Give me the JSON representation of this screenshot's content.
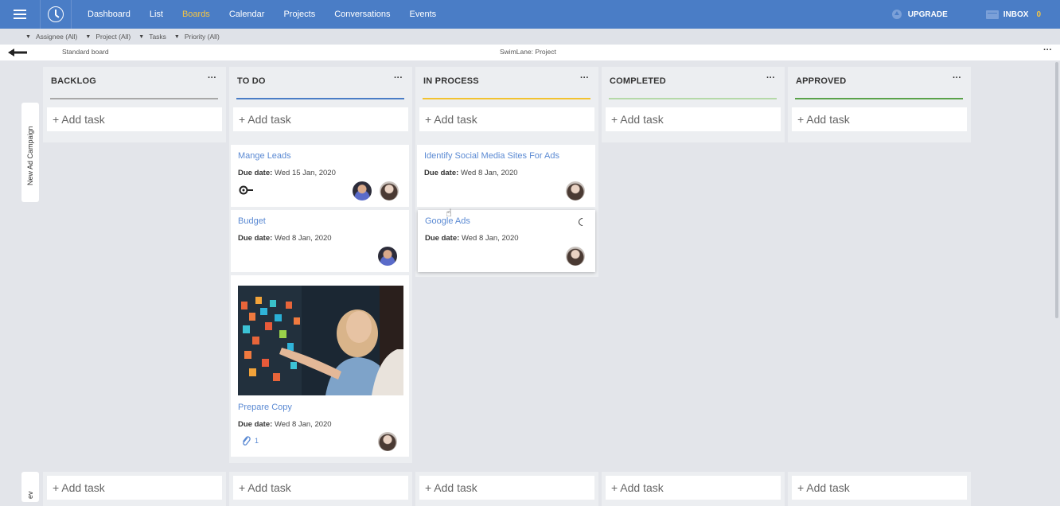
{
  "nav": {
    "items": [
      "Dashboard",
      "List",
      "Boards",
      "Calendar",
      "Projects",
      "Conversations",
      "Events"
    ],
    "active": "Boards",
    "upgrade_label": "UPGRADE",
    "inbox_label": "INBOX",
    "inbox_count": "0"
  },
  "filters": [
    "Assignee (All)",
    "Project (All)",
    "Tasks",
    "Priority (All)"
  ],
  "board": {
    "name": "Standard board",
    "swimlane_label": "SwimLane: Project",
    "more": "···"
  },
  "swimlanes": [
    "New Ad Campaign",
    "ev"
  ],
  "add_task_label": "+ Add task",
  "due_label": "Due date:",
  "colors": {
    "accent": "#4a7dc6",
    "highlight": "#f5c542",
    "link": "#5b8ad3"
  },
  "columns": [
    {
      "title": "BACKLOG",
      "more": "···",
      "color": "#a8a8a8"
    },
    {
      "title": "TO DO",
      "more": "···",
      "color": "#4a7dc6"
    },
    {
      "title": "IN PROCESS",
      "more": "···",
      "color": "#f2c230"
    },
    {
      "title": "COMPLETED",
      "more": "···",
      "color": "#b5d9a8"
    },
    {
      "title": "APPROVED",
      "more": "···",
      "color": "#5aa24a"
    }
  ],
  "cards": {
    "todo": [
      {
        "title": "Mange Leads",
        "due": "Wed 15 Jan, 2020",
        "icon": "toggle-icon"
      },
      {
        "title": "Budget",
        "due": "Wed 8 Jan, 2020"
      },
      {
        "title": "Prepare Copy",
        "due": "Wed 8 Jan, 2020",
        "attachments": "1",
        "image": "sticky-notes-photo"
      }
    ],
    "in_process": [
      {
        "title": "Identify Social Media Sites For Ads",
        "due": "Wed 8 Jan, 2020"
      },
      {
        "title": "Google Ads",
        "due": "Wed 8 Jan, 2020"
      }
    ]
  }
}
